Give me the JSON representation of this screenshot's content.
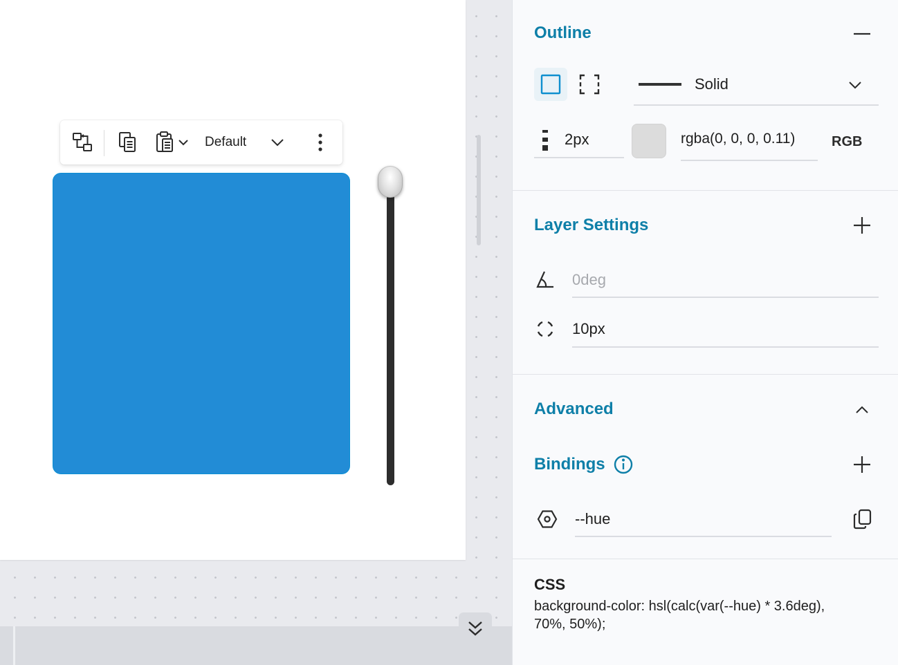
{
  "toolbar": {
    "preset_label": "Default"
  },
  "slider": {
    "value_fraction": 1.0
  },
  "outline": {
    "title": "Outline",
    "style_value": "Solid",
    "width_value": "2px",
    "color_value": "rgba(0, 0, 0, 0.11)",
    "color_mode": "RGB"
  },
  "layer_settings": {
    "title": "Layer Settings",
    "rotation_placeholder": "0deg",
    "radius_value": "10px"
  },
  "advanced": {
    "title": "Advanced"
  },
  "bindings": {
    "title": "Bindings",
    "variable_value": "--hue"
  },
  "css": {
    "heading": "CSS",
    "code": "background-color: hsl(calc(var(--hue) * 3.6deg), 70%, 50%);"
  },
  "colors": {
    "accent": "#0e7fa8",
    "shape_fill": "#228cd6",
    "shape_border": "#0b8fd4",
    "swatch": "#dcdcdc"
  }
}
